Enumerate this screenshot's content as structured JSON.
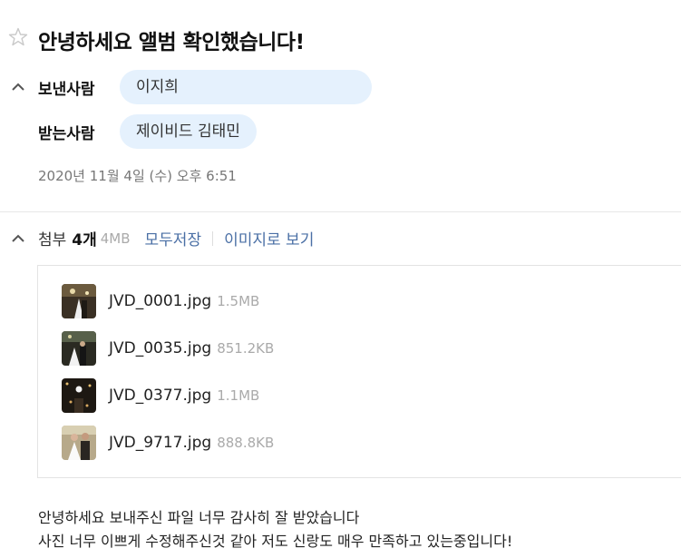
{
  "mail": {
    "subject": "안녕하세요 앨범 확인했습니다!",
    "sender_label": "보낸사람",
    "sender": "이지희",
    "recipient_label": "받는사람",
    "recipient": "제이비드 김태민",
    "date": "2020년 11월 4일 (수) 오후 6:51"
  },
  "attachments": {
    "label": "첨부",
    "count": "4개",
    "total_size": "4MB",
    "save_all": "모두저장",
    "view_images": "이미지로 보기",
    "files": [
      {
        "name": "JVD_0001.jpg",
        "size": "1.5MB"
      },
      {
        "name": "JVD_0035.jpg",
        "size": "851.2KB"
      },
      {
        "name": "JVD_0377.jpg",
        "size": "1.1MB"
      },
      {
        "name": "JVD_9717.jpg",
        "size": "888.8KB"
      }
    ]
  },
  "body": {
    "line1": "안녕하세요 보내주신 파일 너무 감사히 잘 받았습니다",
    "line2": "사진 너무 이쁘게 수정해주신것 같아 저도 신랑도 매우 만족하고 있는중입니다!"
  },
  "icons": {
    "star": "star-outline-icon",
    "collapse": "chevron-up-icon"
  }
}
